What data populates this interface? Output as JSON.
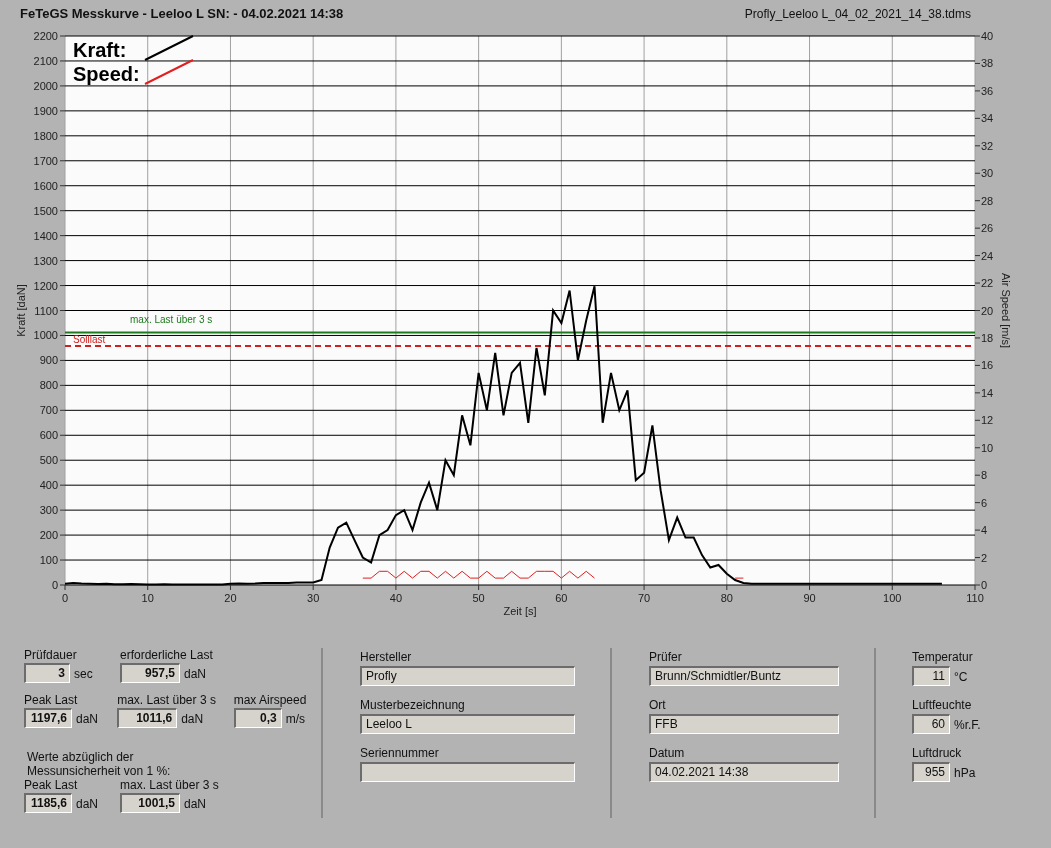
{
  "header": {
    "title": "FeTeGS Messkurve - Leeloo L  SN:  - 04.02.2021 14:38",
    "file_name": "Profly_Leeloo L_04_02_2021_14_38.tdms"
  },
  "chart": {
    "chart_data": {
      "type": "line",
      "xlabel": "Zeit [s]",
      "ylabel": "Kraft [daN]",
      "y2label": "Air Speed [m/s]",
      "xlim": [
        0,
        110
      ],
      "ylim": [
        0,
        2200
      ],
      "y2lim": [
        0,
        40
      ],
      "xticks": [
        0,
        10,
        20,
        30,
        40,
        50,
        60,
        70,
        80,
        90,
        100,
        110
      ],
      "yticks": [
        0,
        100,
        200,
        300,
        400,
        500,
        600,
        700,
        800,
        900,
        1000,
        1100,
        1200,
        1300,
        1400,
        1500,
        1600,
        1700,
        1800,
        1900,
        2000,
        2100,
        2200
      ],
      "y2ticks": [
        0,
        2,
        4,
        6,
        8,
        10,
        12,
        14,
        16,
        18,
        20,
        22,
        24,
        26,
        28,
        30,
        32,
        34,
        36,
        38,
        40
      ],
      "x": [
        0,
        1,
        2,
        3,
        4,
        5,
        6,
        7,
        8,
        9,
        10,
        11,
        12,
        13,
        14,
        15,
        16,
        17,
        18,
        19,
        20,
        21,
        22,
        23,
        24,
        25,
        26,
        27,
        28,
        29,
        30,
        31,
        32,
        33,
        34,
        35,
        36,
        37,
        38,
        39,
        40,
        41,
        42,
        43,
        44,
        45,
        46,
        47,
        48,
        49,
        50,
        51,
        52,
        53,
        54,
        55,
        56,
        57,
        58,
        59,
        60,
        61,
        62,
        63,
        64,
        65,
        66,
        67,
        68,
        69,
        70,
        71,
        72,
        73,
        74,
        75,
        76,
        77,
        78,
        79,
        80,
        81,
        82,
        83,
        84,
        85,
        86,
        87,
        88,
        89,
        90,
        91,
        92,
        93,
        94,
        95,
        96,
        97,
        98,
        99,
        100,
        101,
        102,
        103,
        104,
        105,
        106
      ],
      "series": [
        {
          "name": "Kraft:",
          "color": "#000000",
          "values": [
            5,
            8,
            6,
            5,
            4,
            5,
            3,
            3,
            4,
            3,
            2,
            2,
            3,
            2,
            2,
            2,
            2,
            2,
            2,
            2,
            5,
            6,
            5,
            6,
            8,
            8,
            8,
            8,
            10,
            10,
            10,
            20,
            150,
            230,
            250,
            180,
            110,
            90,
            200,
            220,
            280,
            300,
            220,
            330,
            410,
            300,
            500,
            440,
            680,
            560,
            850,
            700,
            930,
            680,
            850,
            890,
            650,
            950,
            760,
            1100,
            1050,
            1180,
            900,
            1060,
            1197,
            650,
            850,
            700,
            780,
            420,
            450,
            640,
            380,
            180,
            270,
            190,
            190,
            120,
            70,
            80,
            45,
            20,
            8,
            5,
            5,
            5,
            5,
            5,
            5,
            5,
            5,
            5,
            5,
            5,
            5,
            5,
            5,
            5,
            5,
            5,
            5,
            5,
            5,
            5,
            5,
            5,
            5
          ]
        },
        {
          "name": "Speed:",
          "color": "#e02020",
          "axis": "y2",
          "values": [
            null,
            null,
            null,
            null,
            null,
            null,
            null,
            null,
            null,
            null,
            null,
            null,
            null,
            null,
            null,
            null,
            null,
            null,
            null,
            null,
            null,
            null,
            null,
            null,
            null,
            null,
            null,
            null,
            null,
            null,
            null,
            null,
            null,
            null,
            null,
            null,
            0.5,
            0.5,
            1,
            1,
            0.5,
            1,
            0.5,
            1,
            1,
            0.5,
            1,
            0.5,
            1,
            0.5,
            0.5,
            1,
            0.5,
            0.5,
            1,
            0.5,
            0.5,
            1,
            1,
            1,
            0.5,
            1,
            0.5,
            1,
            0.5,
            null,
            null,
            null,
            null,
            null,
            null,
            null,
            null,
            null,
            null,
            null,
            null,
            null,
            null,
            null,
            null,
            0.5,
            0.5,
            null,
            null,
            null,
            null,
            null,
            null,
            null,
            null,
            null,
            null,
            null,
            null,
            null,
            null,
            null,
            null,
            null,
            null,
            null,
            null,
            null,
            null,
            null,
            null
          ]
        }
      ],
      "grid": true,
      "legend": "upper left",
      "ref_lines": [
        {
          "axis": "y",
          "value": 1011.6,
          "label": "max. Last über  3 s",
          "color": "#1e7a1e"
        },
        {
          "axis": "y",
          "value": 957.5,
          "label": "Solllast",
          "color": "#d02020"
        }
      ]
    }
  },
  "results": [
    {
      "label": "Prüfdauer",
      "value": "3",
      "unit": "sec"
    },
    {
      "label": "erforderliche Last",
      "value": "957,5",
      "unit": "daN"
    },
    {
      "label": "Peak Last",
      "value": "1197,6",
      "unit": "daN"
    },
    {
      "label": "max. Last über  3 s",
      "value": "1011,6",
      "unit": "daN"
    },
    {
      "label": "max Airspeed",
      "value": "0,3",
      "unit": "m/s"
    }
  ],
  "uncertainty_note": "Werte abzüglich der\nMessunsicherheit von 1  %:",
  "corrected_results": [
    {
      "label": "Peak Last",
      "value": "1185,6",
      "unit": "daN"
    },
    {
      "label": "max. Last über  3 s",
      "value": "1001,5",
      "unit": "daN"
    }
  ],
  "sample_info": [
    {
      "label": "Hersteller",
      "value": "Profly"
    },
    {
      "label": "Musterbezeichnung",
      "value": "Leeloo L"
    },
    {
      "label": "Seriennummer"
    }
  ],
  "test_info": [
    {
      "label": "Prüfer",
      "value": "Brunn/Schmidtler/Buntz"
    },
    {
      "label": "Ort",
      "value": "FFB"
    },
    {
      "label": "Datum",
      "value": "04.02.2021 14:38"
    }
  ],
  "environment": [
    {
      "label": "Temperatur",
      "value": "11",
      "unit": "°C"
    },
    {
      "label": "Luftfeuchte",
      "value": "60",
      "unit": "%r.F."
    },
    {
      "label": "Luftdruck",
      "value": "955",
      "unit": "hPa"
    }
  ]
}
